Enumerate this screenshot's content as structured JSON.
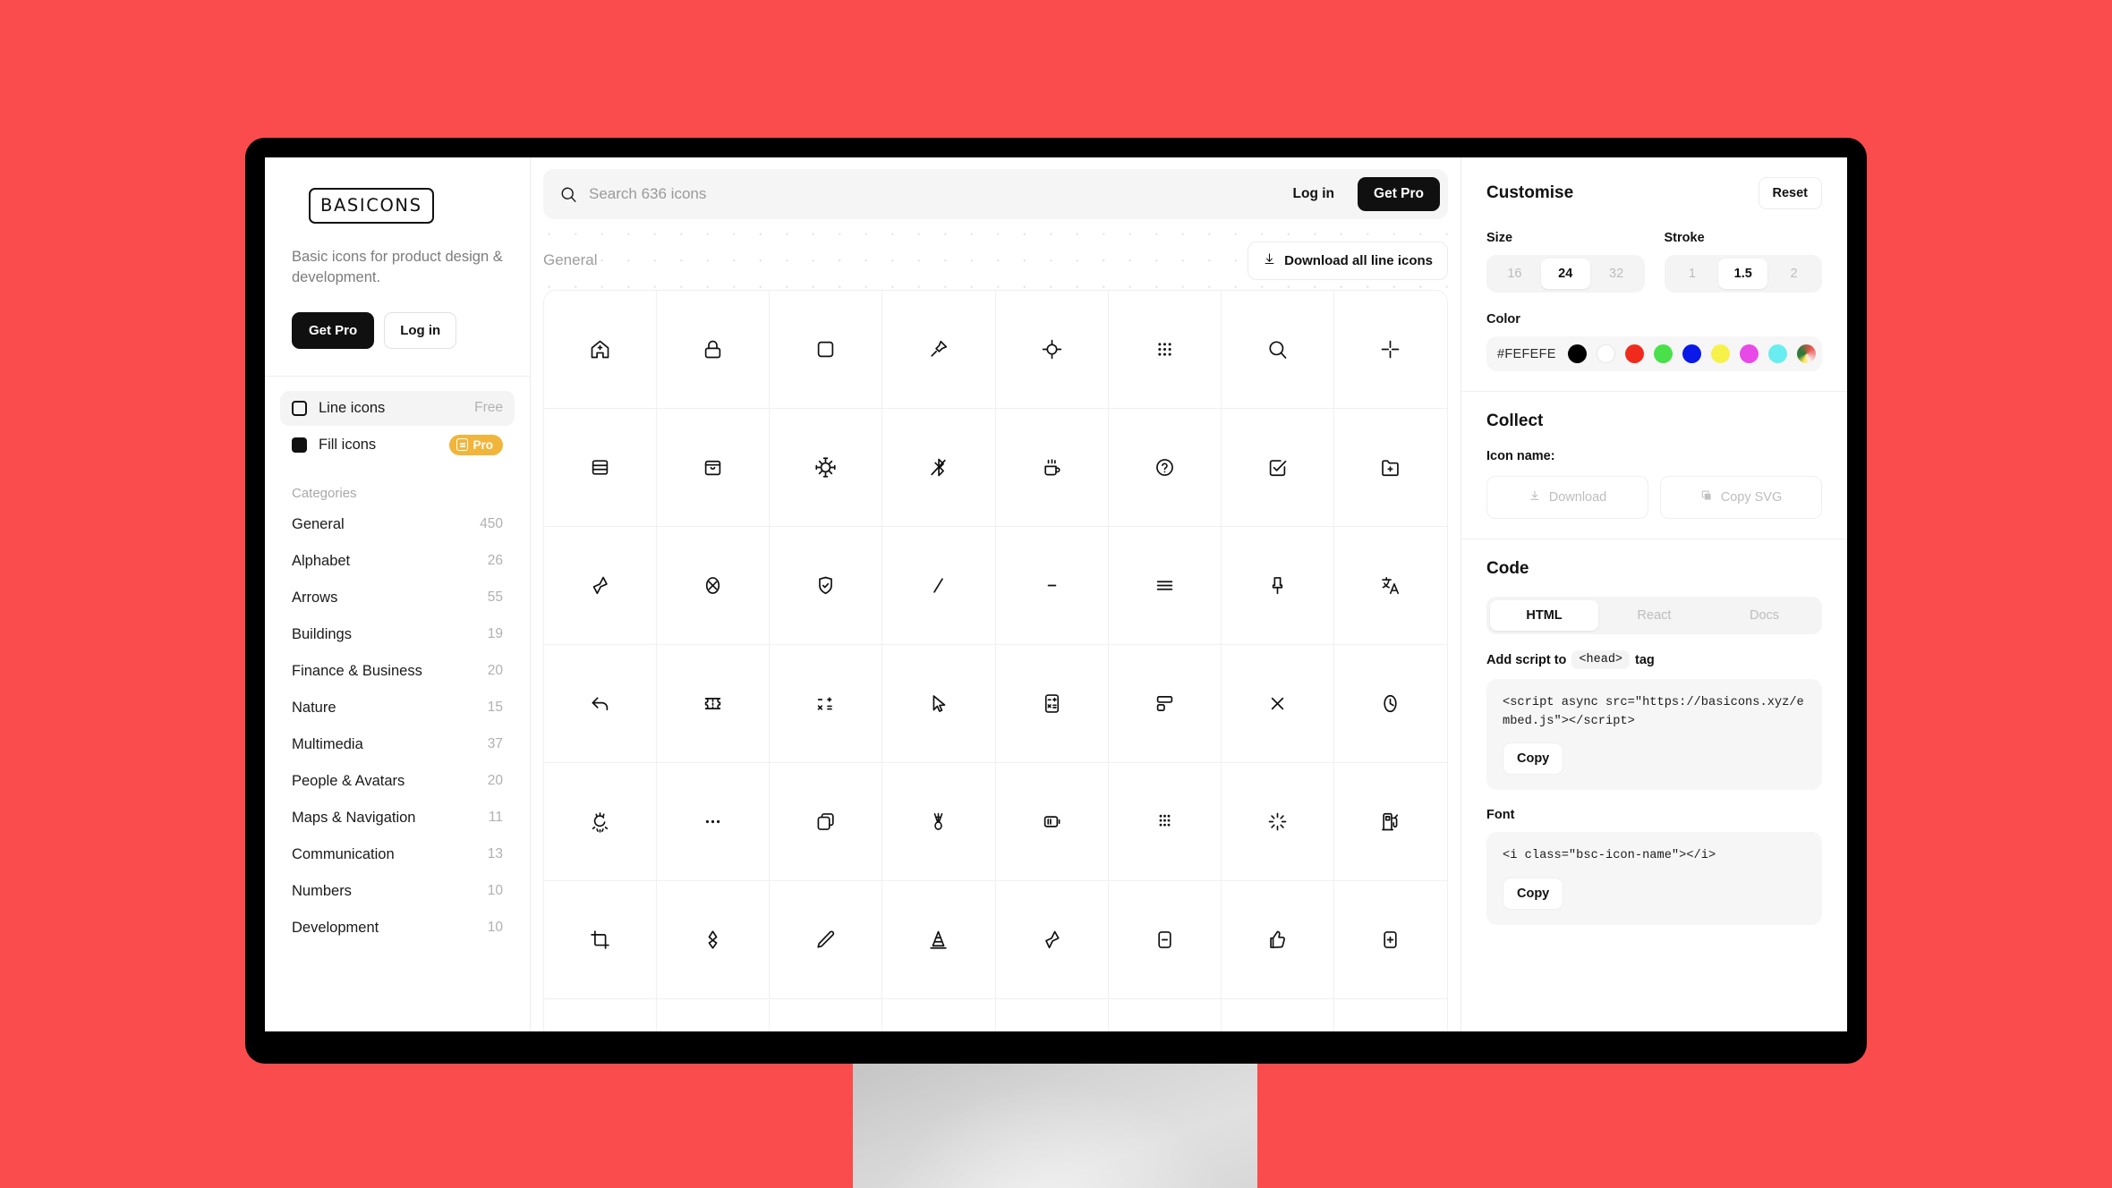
{
  "page": {
    "background_color": "#fa4c4c"
  },
  "sidebar": {
    "logo": "BASICONS",
    "tagline": "Basic icons for product design & development.",
    "get_pro_label": "Get Pro",
    "log_in_label": "Log in",
    "styles": [
      {
        "label": "Line icons",
        "badge": "Free",
        "badge_type": "free",
        "selected": true
      },
      {
        "label": "Fill icons",
        "badge": "Pro",
        "badge_type": "pro",
        "selected": false
      }
    ],
    "categories_title": "Categories",
    "categories": [
      {
        "label": "General",
        "count": "450"
      },
      {
        "label": "Alphabet",
        "count": "26"
      },
      {
        "label": "Arrows",
        "count": "55"
      },
      {
        "label": "Buildings",
        "count": "19"
      },
      {
        "label": "Finance & Business",
        "count": "20"
      },
      {
        "label": "Nature",
        "count": "15"
      },
      {
        "label": "Multimedia",
        "count": "37"
      },
      {
        "label": "People & Avatars",
        "count": "20"
      },
      {
        "label": "Maps & Navigation",
        "count": "11"
      },
      {
        "label": "Communication",
        "count": "13"
      },
      {
        "label": "Numbers",
        "count": "10"
      },
      {
        "label": "Development",
        "count": "10"
      }
    ]
  },
  "header": {
    "search_placeholder": "Search 636 icons",
    "search_value": "",
    "log_in_label": "Log in",
    "get_pro_label": "Get Pro"
  },
  "main": {
    "section_title": "General",
    "download_all_label": "Download all line icons",
    "icons": [
      "home-plus-icon",
      "lock-icon",
      "square-icon",
      "pin-icon",
      "crosshair-icon",
      "grid-dots-icon",
      "search-icon",
      "crop-marks-icon",
      "rows-icon",
      "shopping-bag-icon",
      "virus-icon",
      "bluetooth-off-icon",
      "coffee-mug-icon",
      "help-circle-icon",
      "checkbox-edit-icon",
      "folder-plus-icon",
      "pin-diagonal-icon",
      "x-oval-icon",
      "shield-check-icon",
      "slash-icon",
      "minus-icon",
      "menu-icon",
      "pushpin-icon",
      "translate-icon",
      "reply-icon",
      "ticket-icon",
      "math-operators-icon",
      "cursor-icon",
      "calculator-icon",
      "layout-split-icon",
      "close-x-icon",
      "clock-icon",
      "loading-flash-icon",
      "dots-horizontal-icon",
      "copy-icon",
      "whisk-icon",
      "battery-icon",
      "grid-dots-dense-icon",
      "sparkle-icon",
      "gas-pump-icon",
      "crop-icon",
      "pin-outline-icon",
      "pencil-icon",
      "traffic-cone-icon",
      "pin-filled-icon",
      "minus-box-icon",
      "thumbs-up-icon",
      "plus-box-icon"
    ]
  },
  "customise": {
    "title": "Customise",
    "reset_label": "Reset",
    "size_label": "Size",
    "size_options": [
      "16",
      "24",
      "32"
    ],
    "size_selected": "24",
    "stroke_label": "Stroke",
    "stroke_options": [
      "1",
      "1.5",
      "2"
    ],
    "stroke_selected": "1.5",
    "color_label": "Color",
    "color_value": "#FEFEFE",
    "swatches": [
      "#000000",
      "#FFFFFF",
      "#F02B1D",
      "#4AE04A",
      "#0A19E8",
      "#F7F24A",
      "#E84AE8",
      "#69EDF0",
      "rainbow"
    ]
  },
  "collect": {
    "title": "Collect",
    "icon_name_label": "Icon name:",
    "download_label": "Download",
    "copy_svg_label": "Copy SVG"
  },
  "code": {
    "title": "Code",
    "tabs": [
      "HTML",
      "React",
      "Docs"
    ],
    "tab_selected": "HTML",
    "script_hint_before": "Add script to",
    "script_hint_tag": "<head>",
    "script_hint_after": "tag",
    "script_snippet": "<script async src=\"https://basicons.xyz/embed.js\"></script>",
    "copy_label": "Copy",
    "font_label": "Font",
    "font_snippet": "<i class=\"bsc-icon-name\"></i>",
    "font_copy_label": "Copy"
  }
}
